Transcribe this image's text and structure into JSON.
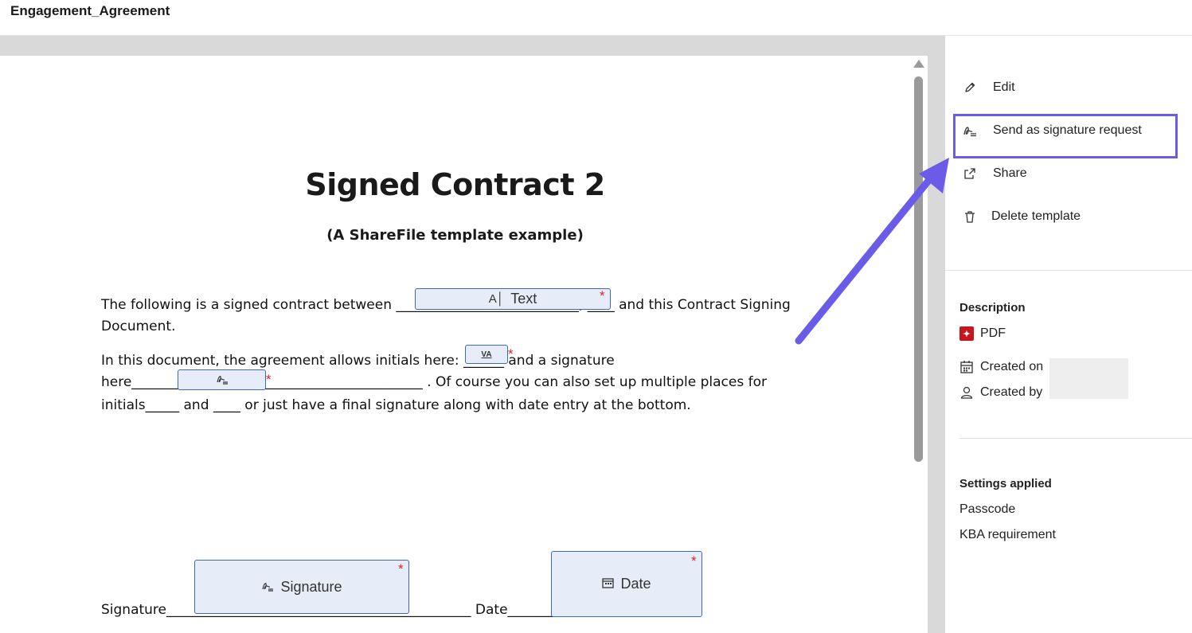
{
  "header": {
    "title": "Engagement_Agreement"
  },
  "document": {
    "title": "Signed Contract 2",
    "subtitle": "(A ShareFile template example)",
    "line1": "The following is a signed contract between ___________________________, ____ and this Contract Signing",
    "line2": "Document.",
    "line3": "In this document, the agreement allows initials here: ______ and a signature",
    "line4": "here___________________________________________ . Of course you can also set up multiple places for",
    "line5": "initials_____ and ____ or just have a final signature along with date entry at the bottom.",
    "line6": "Signature_____________________________________________ Date____________________________"
  },
  "fields": {
    "text_label": "Text",
    "initials_label": "VA",
    "signature_label": "Signature",
    "date_label": "Date",
    "required_mark": "*"
  },
  "sidebar": {
    "menu": [
      {
        "label": "Edit",
        "icon": "pencil-icon"
      },
      {
        "label": "Send as signature request",
        "icon": "signature-icon"
      },
      {
        "label": "Share",
        "icon": "share-icon"
      },
      {
        "label": "Delete template",
        "icon": "trash-icon"
      }
    ],
    "description": {
      "title": "Description",
      "file_type": "PDF",
      "created_on_label": "Created on",
      "created_by_label": "Created by"
    },
    "settings": {
      "title": "Settings applied",
      "items": [
        "Passcode",
        "KBA requirement"
      ]
    }
  },
  "colors": {
    "highlight": "#6b5ce7",
    "field_bg": "#e6edf9",
    "field_border": "#3b6ab8",
    "required": "#e0242a",
    "pdf": "#c4161c"
  }
}
